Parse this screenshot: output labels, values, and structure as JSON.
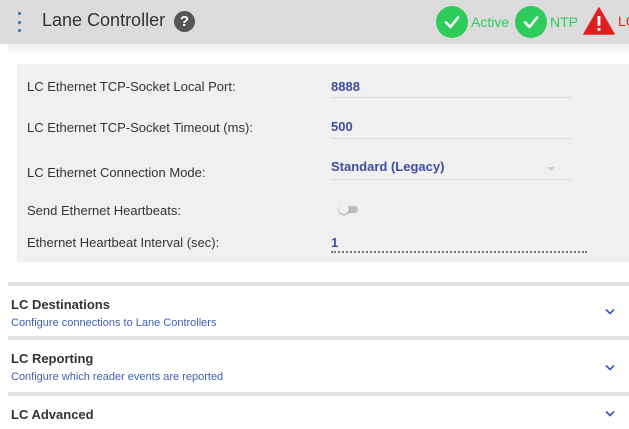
{
  "header": {
    "title": "Lane Controller",
    "help_symbol": "?",
    "statuses": [
      {
        "label": "Active",
        "icon": "check-circle-icon",
        "color": "#2ecc5b"
      },
      {
        "label": "NTP",
        "icon": "check-circle-icon",
        "color": "#2ecc5b"
      },
      {
        "label": "LC",
        "icon": "warning-triangle-icon",
        "color": "#e02020"
      }
    ]
  },
  "settings": {
    "local_port": {
      "label": "LC Ethernet TCP-Socket Local Port:",
      "value": "8888"
    },
    "timeout": {
      "label": "LC Ethernet TCP-Socket Timeout (ms):",
      "value": "500"
    },
    "connection_mode": {
      "label": "LC Ethernet Connection Mode:",
      "value": "Standard (Legacy)"
    },
    "heartbeats": {
      "label": "Send Ethernet Heartbeats:",
      "enabled": false
    },
    "heartbeat_interval": {
      "label": "Ethernet Heartbeat Interval (sec):",
      "value": "1"
    }
  },
  "sections": [
    {
      "title": "LC Destinations",
      "subtitle": "Configure connections to Lane Controllers"
    },
    {
      "title": "LC Reporting",
      "subtitle": "Configure which reader events are reported"
    },
    {
      "title": "LC Advanced",
      "subtitle": ""
    }
  ],
  "colors": {
    "accent": "#3c4ea0",
    "link": "#3f60b0",
    "ok": "#2ecc5b",
    "error": "#e02020"
  }
}
